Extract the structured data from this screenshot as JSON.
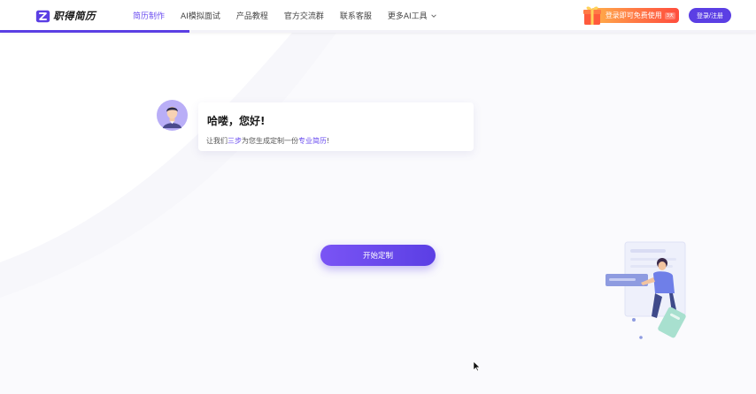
{
  "brand": {
    "name": "职得简历"
  },
  "nav": {
    "items": [
      {
        "label": "简历制作",
        "active": true
      },
      {
        "label": "AI模拟面试",
        "active": false
      },
      {
        "label": "产品教程",
        "active": false
      },
      {
        "label": "官方交流群",
        "active": false
      },
      {
        "label": "联系客服",
        "active": false
      },
      {
        "label": "更多AI工具",
        "active": false,
        "icon": "chevron-down-icon"
      }
    ]
  },
  "progress": {
    "fraction": 0.25
  },
  "promo": {
    "text": "登录即可免费使用",
    "tag": "3天"
  },
  "login": {
    "label": "登录/注册"
  },
  "greeting": {
    "title": "哈喽，您好!",
    "sub_prefix": "让我们",
    "sub_highlight_1": "三步",
    "sub_middle": "为您生成定制一份",
    "sub_highlight_2": "专业简历",
    "sub_suffix": "!"
  },
  "start": {
    "label": "开始定制"
  },
  "colors": {
    "accent": "#5b3fe4",
    "accent_text": "#6a4cf0",
    "promo_start": "#ffb24a",
    "promo_end": "#ff4d3d"
  }
}
